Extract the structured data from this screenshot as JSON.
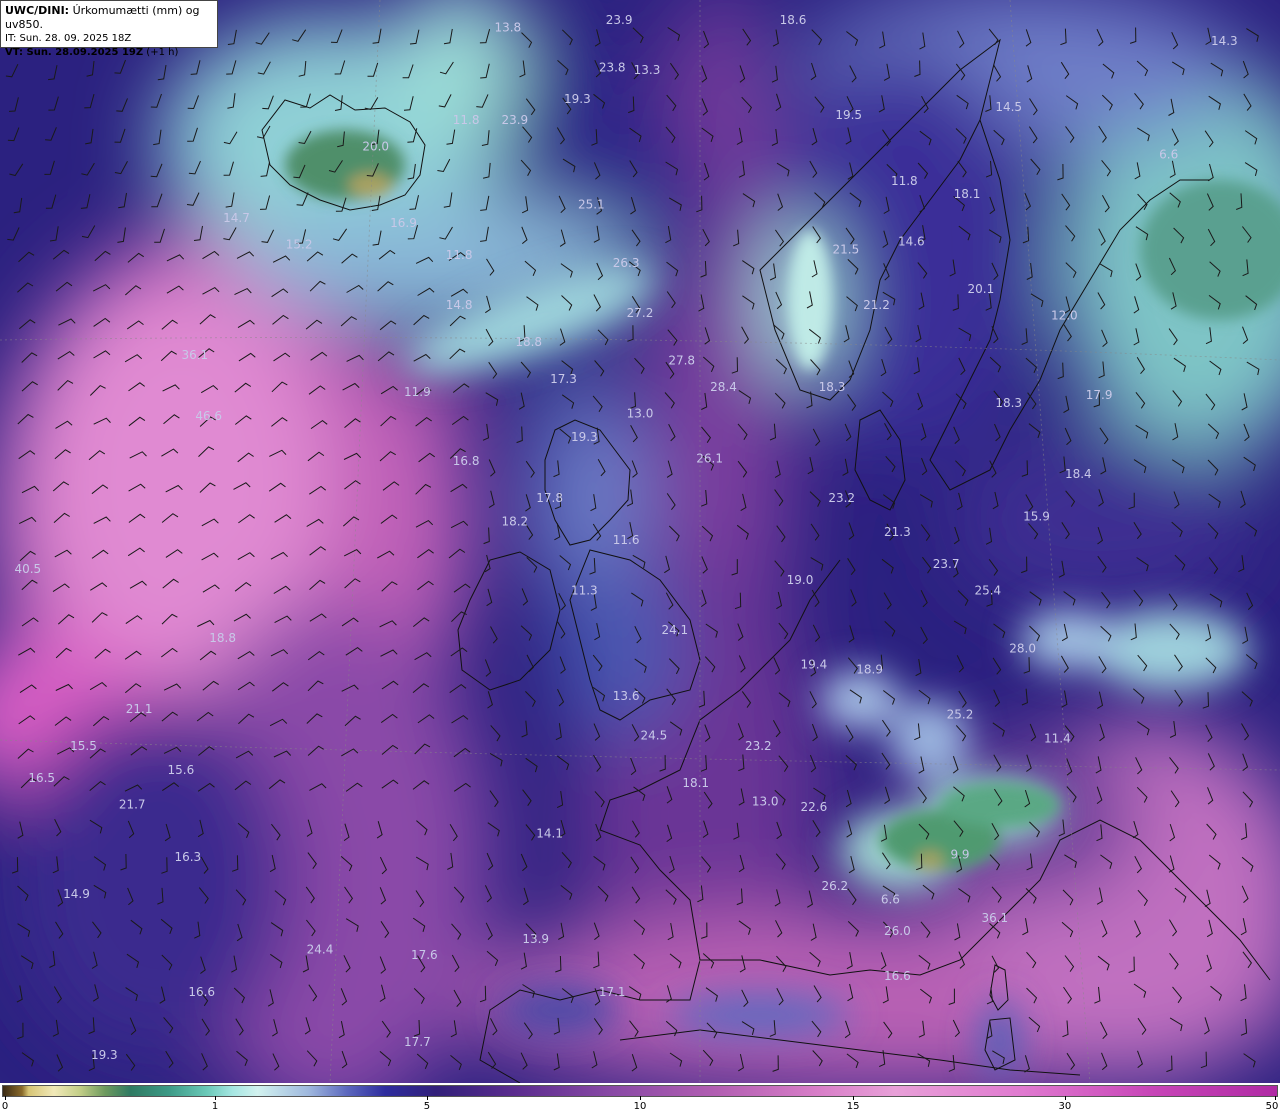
{
  "header": {
    "title_bold": "UWC/DINI:",
    "title_rest": " Úrkomumætti (mm) og uv850.",
    "it_line": "IT: Sun. 28. 09. 2025 18Z",
    "vt_bold": "VT: Sun. 28.09.2025 19Z",
    "vt_rest": " (+1 h)"
  },
  "colorbar": {
    "ticks": [
      {
        "label": "0",
        "value": 0
      },
      {
        "label": "1",
        "value": 1
      },
      {
        "label": "5",
        "value": 5
      },
      {
        "label": "10",
        "value": 10
      },
      {
        "label": "15",
        "value": 15
      },
      {
        "label": "30",
        "value": 30
      },
      {
        "label": "50",
        "value": 50
      }
    ]
  },
  "map_labels": [
    {
      "text": "13.8",
      "lon": -21.5,
      "lat": 67.3
    },
    {
      "text": "23.9",
      "lon": -13.5,
      "lat": 67.6
    },
    {
      "text": "18.6",
      "lon": -1.0,
      "lat": 67.6
    },
    {
      "text": "14.3",
      "lon": 30.0,
      "lat": 66.8
    },
    {
      "text": "23.8",
      "lon": -14.0,
      "lat": 65.8
    },
    {
      "text": "13.3",
      "lon": -11.5,
      "lat": 65.7
    },
    {
      "text": "19.3",
      "lon": -16.5,
      "lat": 64.6
    },
    {
      "text": "11.8",
      "lon": -24.5,
      "lat": 63.8
    },
    {
      "text": "23.9",
      "lon": -21.0,
      "lat": 63.8
    },
    {
      "text": "20.0",
      "lon": -31.0,
      "lat": 62.8
    },
    {
      "text": "19.5",
      "lon": 3.0,
      "lat": 64.0
    },
    {
      "text": "14.5",
      "lon": 14.5,
      "lat": 64.3
    },
    {
      "text": "25.1",
      "lon": -15.5,
      "lat": 60.6
    },
    {
      "text": "11.8",
      "lon": 7.0,
      "lat": 61.5
    },
    {
      "text": "16.9",
      "lon": -29.0,
      "lat": 59.9
    },
    {
      "text": "14.7",
      "lon": -41.0,
      "lat": 60.1
    },
    {
      "text": "15.2",
      "lon": -36.5,
      "lat": 59.1
    },
    {
      "text": "11.8",
      "lon": -25.0,
      "lat": 58.7
    },
    {
      "text": "26.3",
      "lon": -13.0,
      "lat": 58.4
    },
    {
      "text": "18.1",
      "lon": 11.5,
      "lat": 61.0
    },
    {
      "text": "6.6",
      "lon": 26.0,
      "lat": 62.5
    },
    {
      "text": "21.5",
      "lon": 2.8,
      "lat": 58.9
    },
    {
      "text": "14.6",
      "lon": 7.5,
      "lat": 59.2
    },
    {
      "text": "14.8",
      "lon": -25.0,
      "lat": 56.8
    },
    {
      "text": "27.2",
      "lon": -12.0,
      "lat": 56.5
    },
    {
      "text": "21.2",
      "lon": 5.0,
      "lat": 56.8
    },
    {
      "text": "20.1",
      "lon": 12.5,
      "lat": 57.4
    },
    {
      "text": "18.8",
      "lon": -20.0,
      "lat": 55.4
    },
    {
      "text": "27.8",
      "lon": -9.0,
      "lat": 54.7
    },
    {
      "text": "12.0",
      "lon": 18.5,
      "lat": 56.4
    },
    {
      "text": "17.3",
      "lon": -17.5,
      "lat": 54.0
    },
    {
      "text": "28.4",
      "lon": -6.0,
      "lat": 53.7
    },
    {
      "text": "18.3",
      "lon": 1.8,
      "lat": 53.7
    },
    {
      "text": "11.9",
      "lon": -28.0,
      "lat": 53.5
    },
    {
      "text": "36.1",
      "lon": -44.0,
      "lat": 54.9
    },
    {
      "text": "13.0",
      "lon": -12.0,
      "lat": 52.7
    },
    {
      "text": "18.3",
      "lon": 14.5,
      "lat": 53.1
    },
    {
      "text": "17.9",
      "lon": 21.0,
      "lat": 53.4
    },
    {
      "text": "46.6",
      "lon": -43.0,
      "lat": 52.6
    },
    {
      "text": "19.3",
      "lon": -16.0,
      "lat": 51.8
    },
    {
      "text": "16.8",
      "lon": -24.5,
      "lat": 50.9
    },
    {
      "text": "26.1",
      "lon": -7.0,
      "lat": 51.0
    },
    {
      "text": "17.8",
      "lon": -18.5,
      "lat": 49.5
    },
    {
      "text": "18.4",
      "lon": 19.5,
      "lat": 50.4
    },
    {
      "text": "23.2",
      "lon": 2.5,
      "lat": 49.5
    },
    {
      "text": "18.2",
      "lon": -21.0,
      "lat": 48.6
    },
    {
      "text": "15.9",
      "lon": 16.5,
      "lat": 48.8
    },
    {
      "text": "21.3",
      "lon": 6.5,
      "lat": 48.2
    },
    {
      "text": "11.6",
      "lon": -13.0,
      "lat": 47.9
    },
    {
      "text": "23.7",
      "lon": 10.0,
      "lat": 47.0
    },
    {
      "text": "19.0",
      "lon": -0.5,
      "lat": 46.4
    },
    {
      "text": "40.5",
      "lon": -56.0,
      "lat": 46.8
    },
    {
      "text": "11.3",
      "lon": -16.0,
      "lat": 46.0
    },
    {
      "text": "25.4",
      "lon": 13.0,
      "lat": 46.0
    },
    {
      "text": "24.1",
      "lon": -9.5,
      "lat": 44.5
    },
    {
      "text": "28.0",
      "lon": 15.5,
      "lat": 43.8
    },
    {
      "text": "18.8",
      "lon": -42.0,
      "lat": 44.2
    },
    {
      "text": "19.4",
      "lon": 0.5,
      "lat": 43.2
    },
    {
      "text": "18.9",
      "lon": 4.5,
      "lat": 43.0
    },
    {
      "text": "13.6",
      "lon": -13.0,
      "lat": 42.0
    },
    {
      "text": "21.1",
      "lon": -48.0,
      "lat": 41.5
    },
    {
      "text": "25.2",
      "lon": 11.0,
      "lat": 41.3
    },
    {
      "text": "24.5",
      "lon": -11.0,
      "lat": 40.5
    },
    {
      "text": "15.5",
      "lon": -52.0,
      "lat": 40.1
    },
    {
      "text": "23.2",
      "lon": -3.5,
      "lat": 40.1
    },
    {
      "text": "11.4",
      "lon": 18.0,
      "lat": 40.4
    },
    {
      "text": "16.5",
      "lon": -55.0,
      "lat": 38.9
    },
    {
      "text": "15.6",
      "lon": -45.0,
      "lat": 39.2
    },
    {
      "text": "18.1",
      "lon": -8.0,
      "lat": 38.7
    },
    {
      "text": "21.7",
      "lon": -48.5,
      "lat": 37.9
    },
    {
      "text": "13.0",
      "lon": -3.0,
      "lat": 38.0
    },
    {
      "text": "22.6",
      "lon": 0.5,
      "lat": 37.8
    },
    {
      "text": "14.1",
      "lon": -18.5,
      "lat": 36.8
    },
    {
      "text": "16.3",
      "lon": -44.5,
      "lat": 35.9
    },
    {
      "text": "9.9",
      "lon": 11.0,
      "lat": 36.0
    },
    {
      "text": "14.9",
      "lon": -52.5,
      "lat": 34.5
    },
    {
      "text": "26.2",
      "lon": 2.0,
      "lat": 34.8
    },
    {
      "text": "6.6",
      "lon": 6.0,
      "lat": 34.3
    },
    {
      "text": "24.4",
      "lon": -35.0,
      "lat": 32.4
    },
    {
      "text": "17.6",
      "lon": -27.5,
      "lat": 32.2
    },
    {
      "text": "13.9",
      "lon": -19.5,
      "lat": 32.8
    },
    {
      "text": "26.0",
      "lon": 6.5,
      "lat": 33.1
    },
    {
      "text": "36.1",
      "lon": 13.5,
      "lat": 33.6
    },
    {
      "text": "16.6",
      "lon": -43.5,
      "lat": 30.8
    },
    {
      "text": "17.1",
      "lon": -14.0,
      "lat": 30.8
    },
    {
      "text": "16.6",
      "lon": 6.5,
      "lat": 31.4
    },
    {
      "text": "19.3",
      "lon": -50.5,
      "lat": 28.4
    },
    {
      "text": "17.7",
      "lon": -28.0,
      "lat": 28.9
    }
  ],
  "colors": {
    "ocean_base": "#2a1f7a",
    "colorbar_bg": "#ffffff",
    "label": "#c8c8e8",
    "coast": "#111111"
  }
}
